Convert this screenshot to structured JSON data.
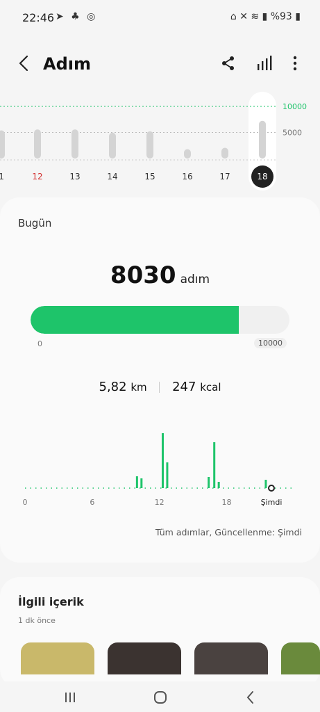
{
  "status_bar": {
    "time": "22:46",
    "battery": "%93"
  },
  "header": {
    "title": "Adım",
    "icons": [
      "back-arrow-icon",
      "share-icon",
      "bar-chart-icon",
      "more-vertical-icon"
    ]
  },
  "week_chart": {
    "goal_label": "10000",
    "mid_label": "5000",
    "days": [
      {
        "label": "1",
        "steps": 6000,
        "color": "#333333"
      },
      {
        "label": "12",
        "steps": 6200,
        "color": "#d32f2f"
      },
      {
        "label": "13",
        "steps": 6200,
        "color": "#333333"
      },
      {
        "label": "14",
        "steps": 5500,
        "color": "#333333"
      },
      {
        "label": "15",
        "steps": 5800,
        "color": "#333333"
      },
      {
        "label": "16",
        "steps": 2000,
        "color": "#333333"
      },
      {
        "label": "17",
        "steps": 2300,
        "color": "#333333"
      },
      {
        "label": "18",
        "steps": 8030,
        "color": "#ffffff"
      }
    ],
    "selected": "18"
  },
  "today": {
    "heading": "Bugün",
    "steps": "8030",
    "unit": "adım",
    "goal": 10000,
    "progress": 0.803,
    "bar_min": "0",
    "bar_max": "10000",
    "distance": "5,82",
    "distance_unit": "km",
    "calories": "247",
    "calories_unit": "kcal",
    "accent": "#1ec46a"
  },
  "chart_data": {
    "type": "bar",
    "x_tick_labels": [
      "0",
      "6",
      "12",
      "18",
      "Şimdi"
    ],
    "hourly_steps": [
      {
        "hour": 10,
        "steps": 170
      },
      {
        "hour": 10.4,
        "steps": 140
      },
      {
        "hour": 12.3,
        "steps": 790
      },
      {
        "hour": 12.7,
        "steps": 370
      },
      {
        "hour": 16.4,
        "steps": 160
      },
      {
        "hour": 16.9,
        "steps": 660
      },
      {
        "hour": 17.3,
        "steps": 90
      },
      {
        "hour": 21.5,
        "steps": 120
      }
    ],
    "max_steps": 800
  },
  "footer_note": "Tüm adımlar, Güncellenme: Şimdi",
  "related": {
    "title": "İlgili içerik",
    "time": "1 dk önce",
    "thumbnails": [
      {
        "name": "yoga-thumbnail",
        "color": "#c9b86a"
      },
      {
        "name": "runner-thumbnail",
        "color": "#3b3330"
      },
      {
        "name": "fitness-thumbnail",
        "color": "#4a4240"
      },
      {
        "name": "track-thumbnail",
        "color": "#6a8a3c"
      }
    ]
  },
  "nav": {
    "icons": [
      "recent-apps-icon",
      "home-icon",
      "back-icon"
    ]
  }
}
